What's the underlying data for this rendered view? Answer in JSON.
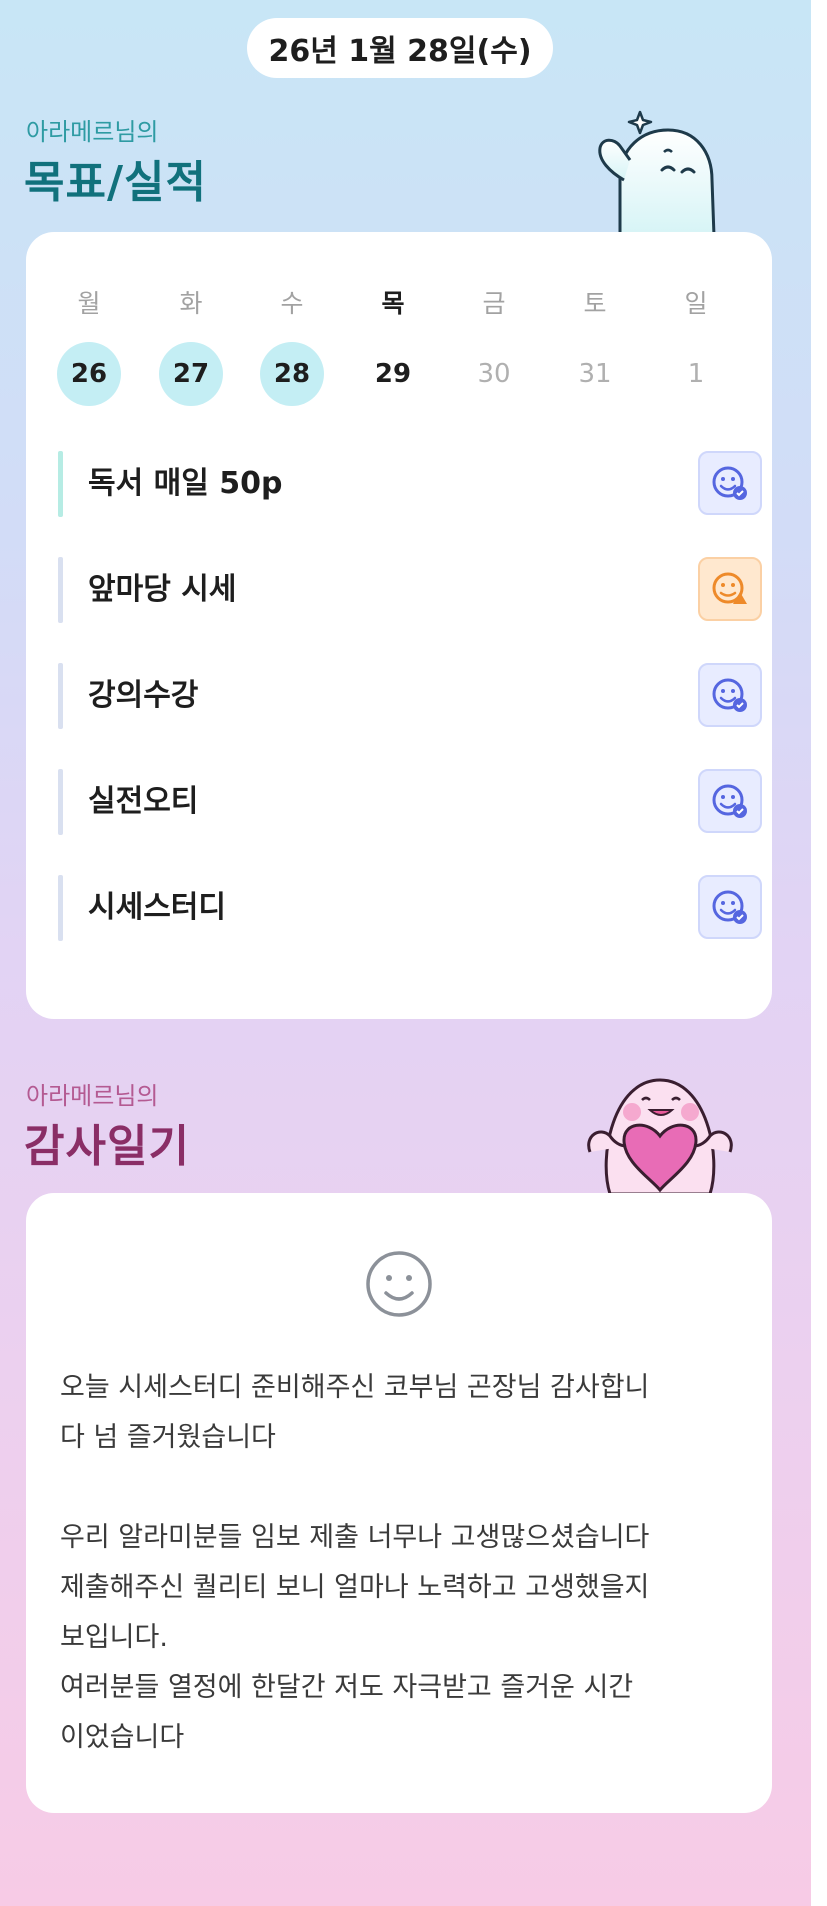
{
  "header": {
    "date": "26년 1월 28일(수)"
  },
  "goals_section": {
    "subtitle": "아라메르님의",
    "title": "목표/실적",
    "weekdays": [
      "월",
      "화",
      "수",
      "목",
      "금",
      "토",
      "일"
    ],
    "dates": [
      {
        "day": "26",
        "state": "done"
      },
      {
        "day": "27",
        "state": "done"
      },
      {
        "day": "28",
        "state": "done"
      },
      {
        "day": "29",
        "state": "today"
      },
      {
        "day": "30",
        "state": "future"
      },
      {
        "day": "31",
        "state": "future"
      },
      {
        "day": "1",
        "state": "future"
      }
    ],
    "today_index": 3,
    "goals": [
      {
        "label": "독서 매일 50p",
        "status_icon": "smile-check-icon",
        "status": "good"
      },
      {
        "label": "앞마당 시세",
        "status_icon": "smile-warning-icon",
        "status": "warning"
      },
      {
        "label": "강의수강",
        "status_icon": "smile-check-icon",
        "status": "good"
      },
      {
        "label": "실전오티",
        "status_icon": "smile-check-icon",
        "status": "good"
      },
      {
        "label": "시세스터디",
        "status_icon": "smile-check-icon",
        "status": "good"
      }
    ]
  },
  "diary_section": {
    "subtitle": "아라메르님의",
    "title": "감사일기",
    "mood_icon": "smile-face-icon",
    "text": "오늘 시세스터디 준비해주신 코부님 곤장님 감사합니\n다 넘 즐거웠습니다\n\n우리 알라미분들 임보 제출 너무나 고생많으셨습니다\n제출해주신 퀄리티 보니 얼마나 노력하고 고생했을지\n보입니다.\n여러분들 열정에 한달간 저도 자극받고 즐거운 시간\n이었습니다"
  },
  "colors": {
    "done_circle": "#c4eef4",
    "goal_title": "#11717c",
    "diary_title": "#8a2e66",
    "status_good_bg": "#e8ecff",
    "status_warn_bg": "#ffe8cf",
    "status_good_stroke": "#5566e0",
    "status_warn_stroke": "#ee8a2a"
  }
}
